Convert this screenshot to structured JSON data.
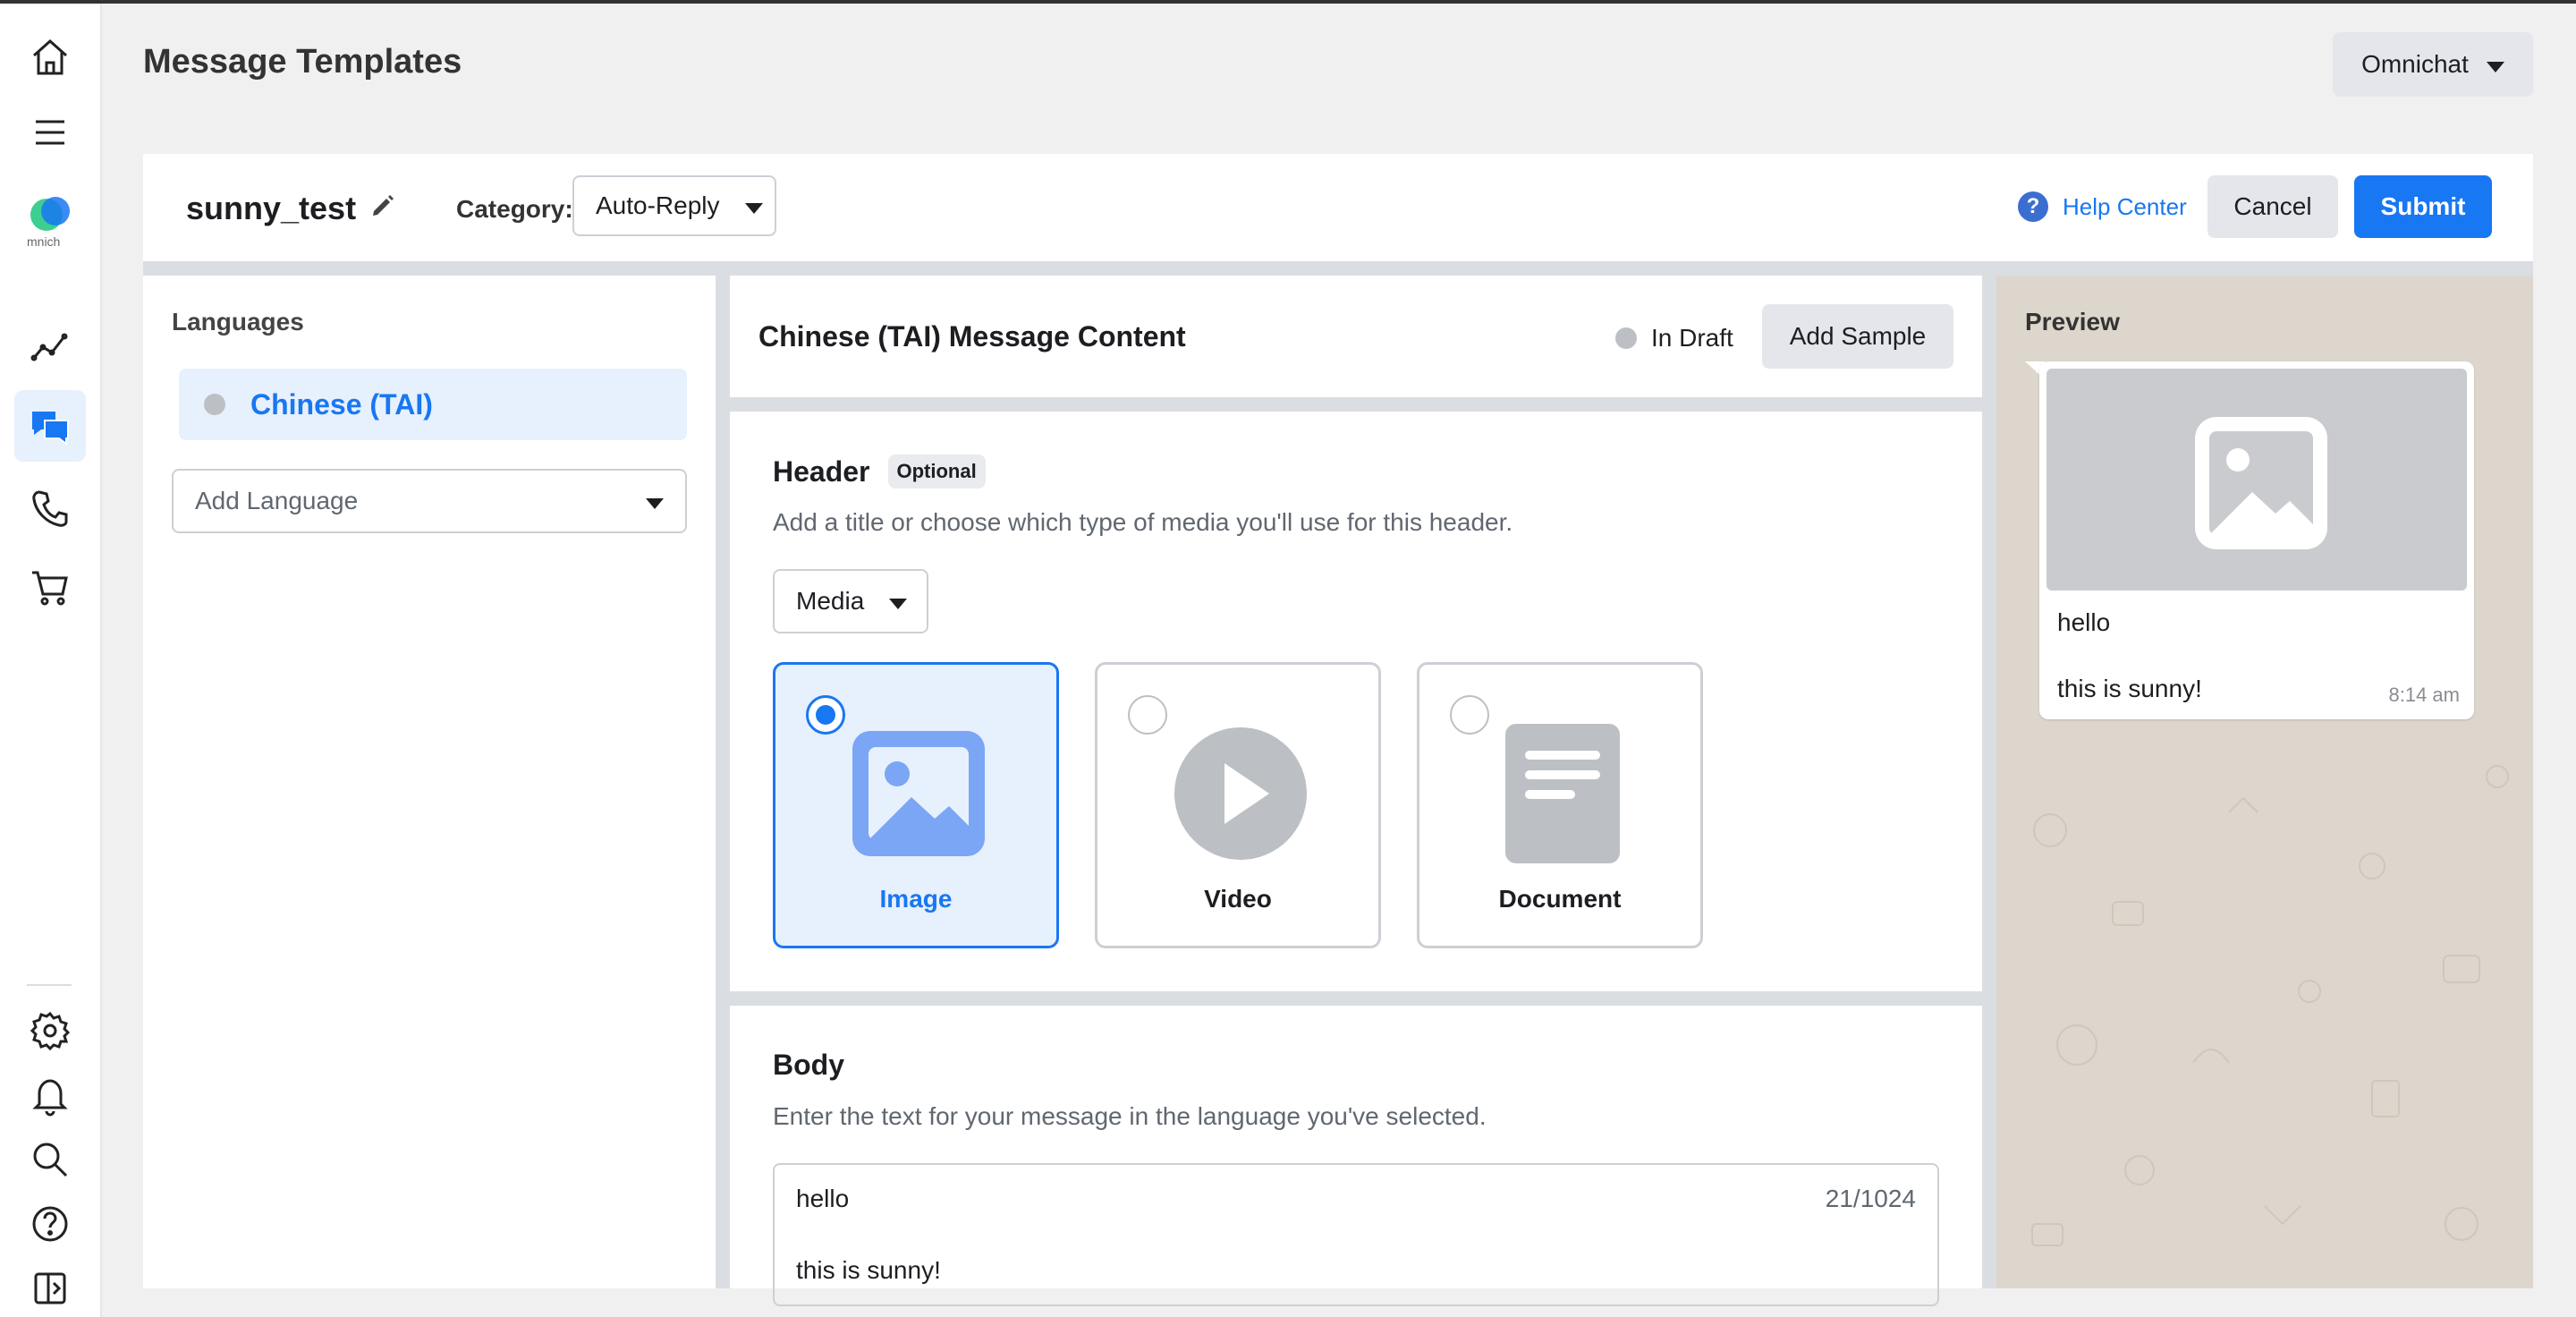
{
  "page": {
    "title": "Message Templates"
  },
  "account": {
    "label": "Omnichat"
  },
  "rail": {
    "logo_text": "mnich",
    "icons": [
      "home-icon",
      "menu-icon",
      "logo",
      "analytics-icon",
      "chat-icon",
      "phone-icon",
      "cart-icon",
      "settings-icon",
      "bell-icon",
      "search-icon",
      "help-icon",
      "collapse-icon"
    ]
  },
  "template": {
    "name": "sunny_test",
    "category_label": "Category:",
    "category_value": "Auto-Reply",
    "help_label": "Help Center",
    "cancel_label": "Cancel",
    "submit_label": "Submit"
  },
  "languages": {
    "title": "Languages",
    "items": [
      {
        "label": "Chinese (TAI)"
      }
    ],
    "add_placeholder": "Add Language"
  },
  "content": {
    "title": "Chinese (TAI) Message Content",
    "status": "In Draft",
    "add_sample_label": "Add Sample",
    "header": {
      "title": "Header",
      "badge": "Optional",
      "description": "Add a title or choose which type of media you'll use for this header.",
      "type": "Media",
      "options": [
        {
          "label": "Image",
          "selected": true
        },
        {
          "label": "Video",
          "selected": false
        },
        {
          "label": "Document",
          "selected": false
        }
      ]
    },
    "body": {
      "title": "Body",
      "description": "Enter the text for your message in the language you've selected.",
      "line1": "hello",
      "line2": "this is sunny!",
      "counter": "21/1024"
    }
  },
  "preview": {
    "title": "Preview",
    "line1": "hello",
    "line2": "this is sunny!",
    "time": "8:14 am"
  },
  "colors": {
    "accent": "#1877f2",
    "selected_bg": "#e7f0fd",
    "preview_bg": "#ddd6cd"
  }
}
